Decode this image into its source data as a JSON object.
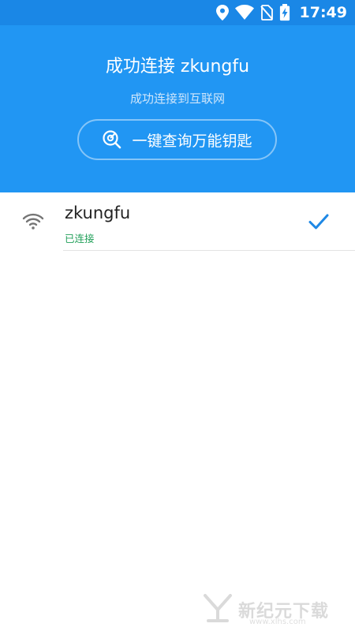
{
  "status_bar": {
    "time": "17:49",
    "icons": [
      "location-icon",
      "wifi-status-icon",
      "no-sim-icon",
      "battery-charging-icon"
    ]
  },
  "header": {
    "title": "成功连接 zkungfu",
    "subtitle": "成功连接到互联网",
    "key_button_label": "一键查询万能钥匙"
  },
  "networks": [
    {
      "ssid": "zkungfu",
      "status": "已连接",
      "connected": true
    }
  ],
  "colors": {
    "header_bg": "#2196f3",
    "status_bar_bg": "#1a87e6",
    "connected_text": "#22a05a",
    "check_mark": "#1e88e5"
  },
  "watermark": {
    "text": "新纪元下载",
    "url": "www.xlhs.com"
  }
}
